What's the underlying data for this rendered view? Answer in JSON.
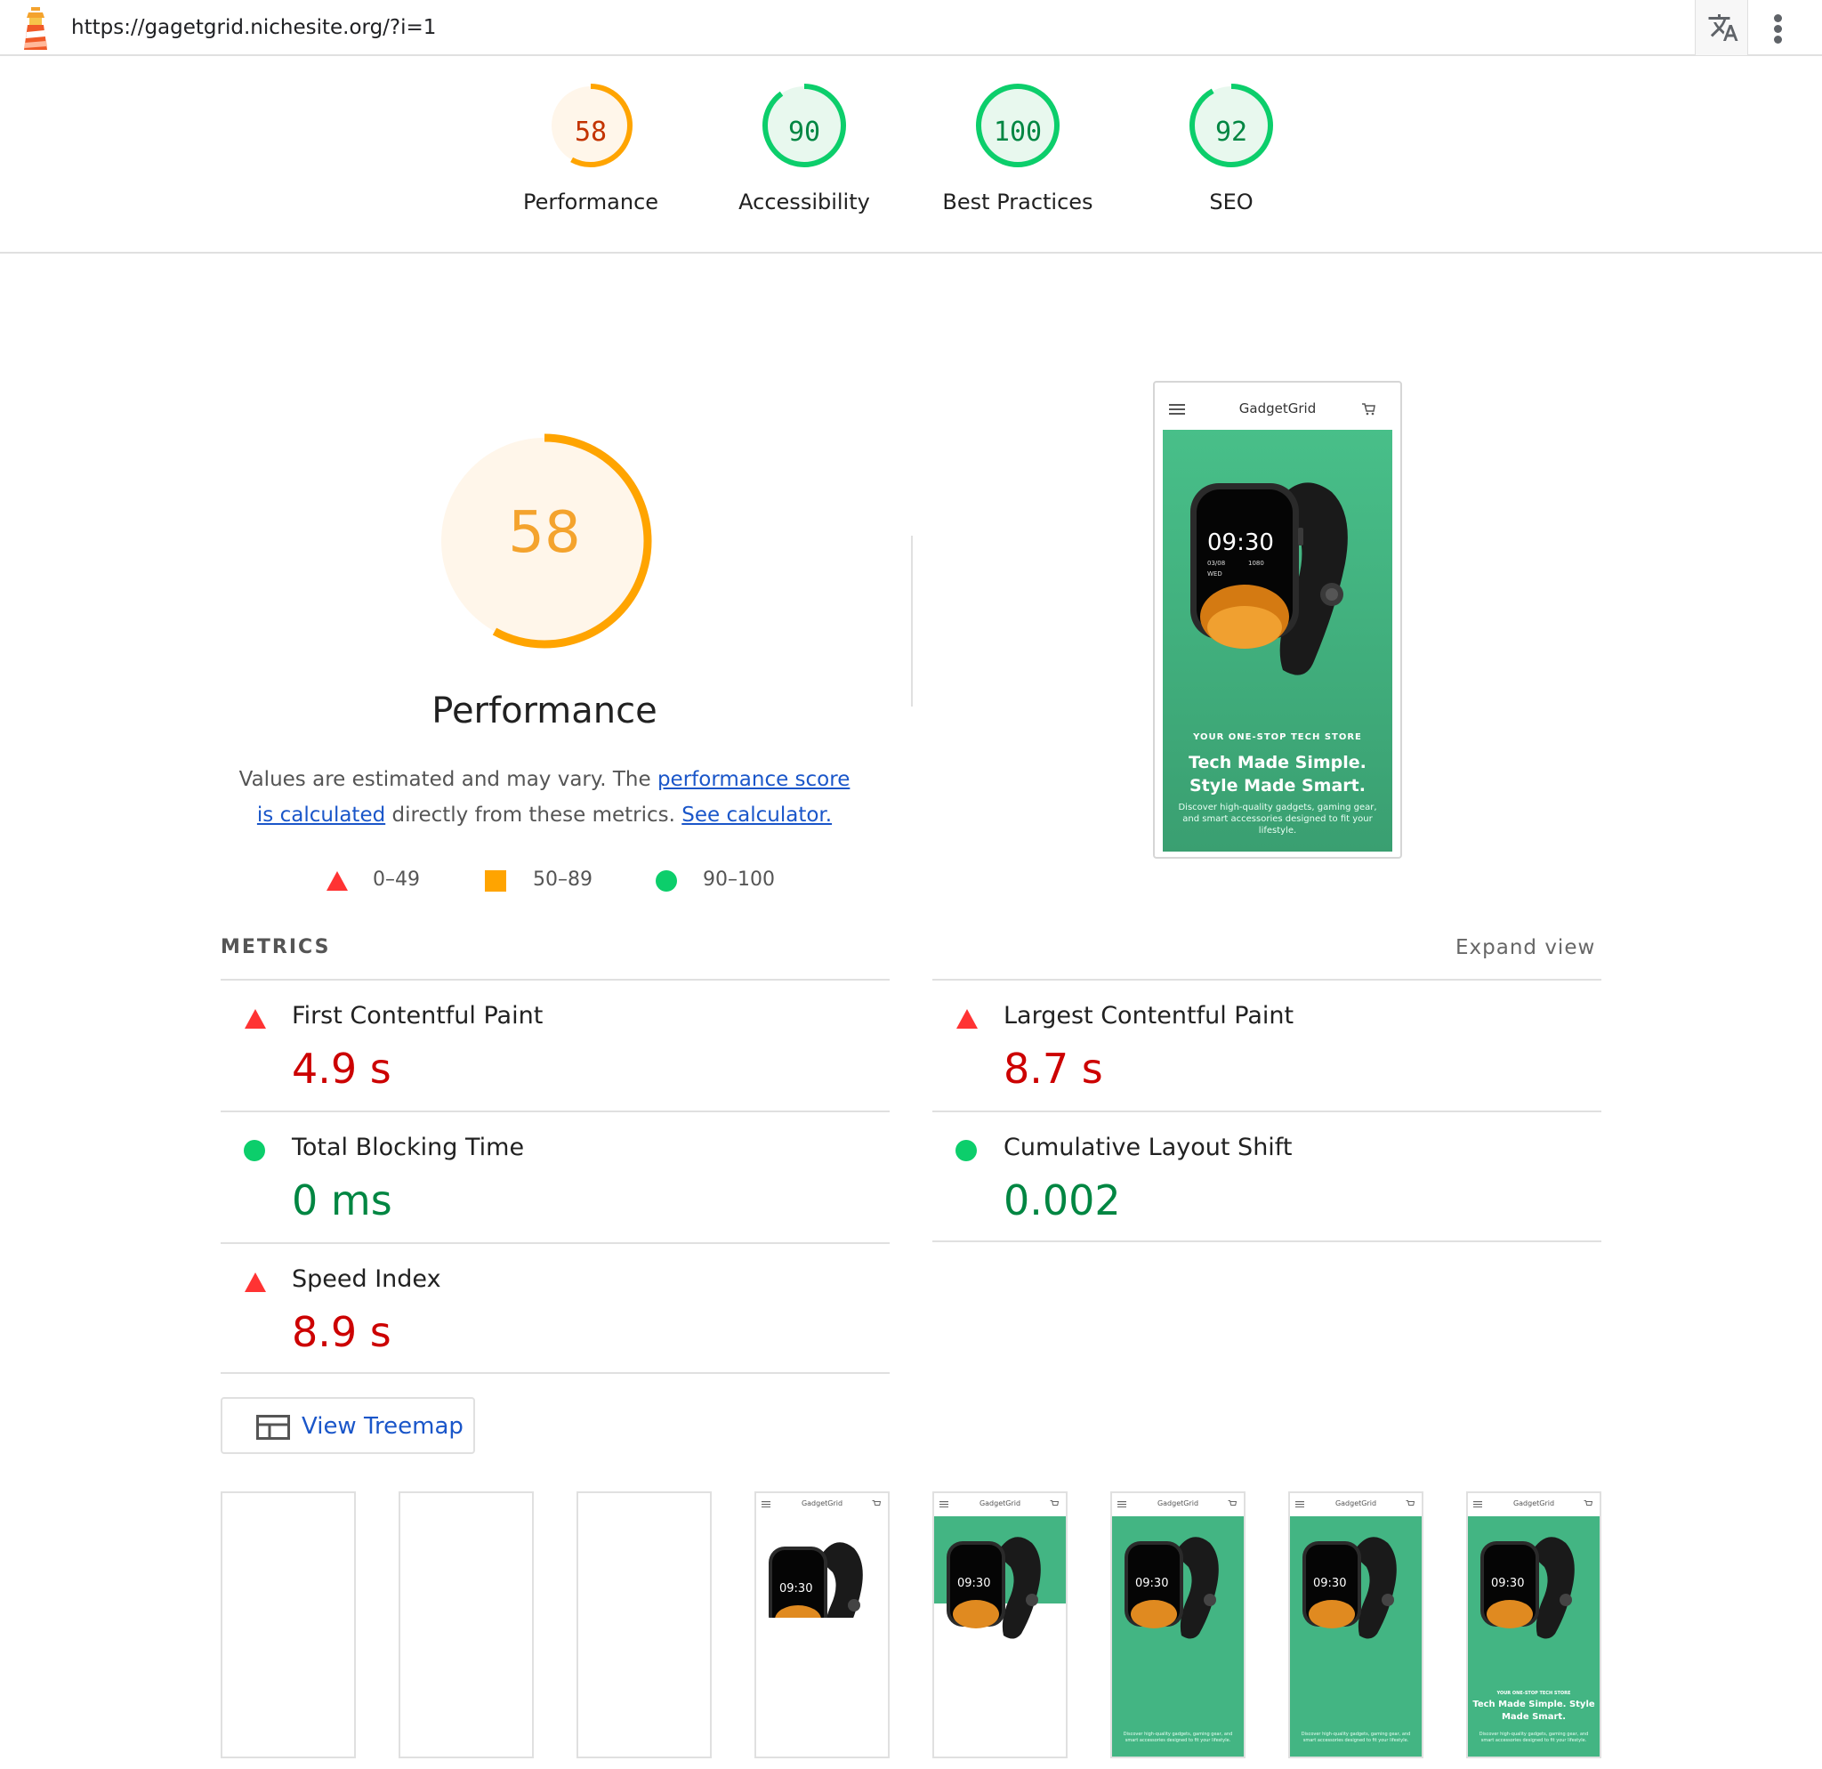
{
  "browser": {
    "url": "https://gagetgrid.nichesite.org/?i=1"
  },
  "colors": {
    "fail": "#ff3333",
    "average": "#ffa400",
    "pass": "#0cce6b",
    "link": "#1a56c9",
    "hero_green": "#43b583"
  },
  "categories": [
    {
      "name": "Performance",
      "score": "58",
      "value": 58,
      "rating": "average"
    },
    {
      "name": "Accessibility",
      "score": "90",
      "value": 90,
      "rating": "pass"
    },
    {
      "name": "Best Practices",
      "score": "100",
      "value": 100,
      "rating": "pass"
    },
    {
      "name": "SEO",
      "score": "92",
      "value": 92,
      "rating": "pass"
    }
  ],
  "performance": {
    "score": "58",
    "value": 58,
    "title": "Performance",
    "desc_prefix": "Values are estimated and may vary. The ",
    "desc_link": "performance score is calculated",
    "desc_middle": " directly from these metrics. ",
    "desc_link2": "See calculator.",
    "legend": [
      {
        "shape": "triangle",
        "range": "0–49"
      },
      {
        "shape": "square",
        "range": "50–89"
      },
      {
        "shape": "circle",
        "range": "90–100"
      }
    ]
  },
  "preview": {
    "brand": "GadgetGrid",
    "watch_time": "09:30",
    "watch_date": "03/08",
    "watch_day": "WED",
    "watch_steps": "1080",
    "tagline": "YOUR ONE-STOP TECH STORE",
    "headline": "Tech Made Simple. Style Made Smart.",
    "subtext": "Discover high-quality gadgets, gaming gear, and smart accessories designed to fit your lifestyle."
  },
  "metrics": {
    "header": "METRICS",
    "expand_label": "Expand view",
    "items": [
      {
        "name": "First Contentful Paint",
        "value": "4.9 s",
        "rating": "fail"
      },
      {
        "name": "Largest Contentful Paint",
        "value": "8.7 s",
        "rating": "fail"
      },
      {
        "name": "Total Blocking Time",
        "value": "0 ms",
        "rating": "pass"
      },
      {
        "name": "Cumulative Layout Shift",
        "value": "0.002",
        "rating": "pass"
      },
      {
        "name": "Speed Index",
        "value": "8.9 s",
        "rating": "fail"
      }
    ]
  },
  "treemap": {
    "label": "View Treemap"
  },
  "filmstrip": {
    "frames": [
      {
        "state": "blank"
      },
      {
        "state": "blank"
      },
      {
        "state": "blank"
      },
      {
        "state": "watch-only"
      },
      {
        "state": "partial-green"
      },
      {
        "state": "green-sub"
      },
      {
        "state": "green-sub"
      },
      {
        "state": "full"
      }
    ]
  }
}
